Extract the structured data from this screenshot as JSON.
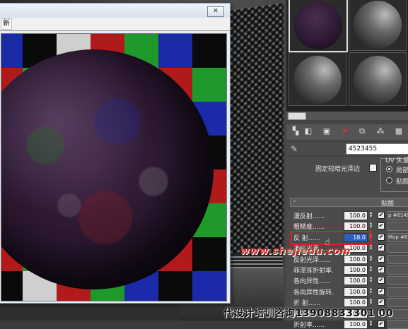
{
  "window": {
    "close_label": "✕",
    "menu_item": "新"
  },
  "checker_colors": [
    "#0a0a0a",
    "#1a2aa8",
    "#0a0a0a",
    "#cfcfcf",
    "#b01a1a",
    "#1f9a2a",
    "#1a2aa8",
    "#0a0a0a",
    "#b01a1a",
    "#1f9a2a",
    "#cfcfcf"
  ],
  "material_editor": {
    "material_name": "4523455",
    "checkbox_label": "固定较暗光泽边",
    "uv_group_label": "UV 失量",
    "radio_options": [
      "局部",
      "贴图"
    ],
    "maps_rollout_label": "贴图",
    "maps_rollout_toggle": "-",
    "map_rows": [
      {
        "label": "漫反射......",
        "value": "100.0",
        "checked": true,
        "map": "p #6149"
      },
      {
        "label": "粗糙度......",
        "value": "100.0",
        "checked": true,
        "map": ""
      },
      {
        "label": "反  射......",
        "value": "18.0",
        "checked": true,
        "map": "Map #6"
      },
      {
        "label": "高光光泽......",
        "value": "100.0",
        "checked": true,
        "map": ""
      },
      {
        "label": "反射光泽......",
        "value": "100.0",
        "checked": true,
        "map": ""
      },
      {
        "label": "菲涅耳折射率.",
        "value": "100.0",
        "checked": true,
        "map": ""
      },
      {
        "label": "各向异性......",
        "value": "100.0",
        "checked": true,
        "map": ""
      },
      {
        "label": "各向异性旋转.",
        "value": "100.0",
        "checked": true,
        "map": ""
      },
      {
        "label": "折  射......",
        "value": "100.0",
        "checked": true,
        "map": ""
      },
      {
        "label": "光泽度......",
        "value": "100.0",
        "checked": true,
        "map": ""
      },
      {
        "label": "折射率......",
        "value": "100.0",
        "checked": true,
        "map": ""
      }
    ],
    "toolbar_icons": [
      "get-material-icon",
      "put-to-scene-icon",
      "assign-material-icon",
      "delete-icon",
      "copy-icon",
      "unique-icon",
      "put-to-library-icon"
    ]
  },
  "watermark": "www.shejiedu.com",
  "footer_text": "代设计培训咨询13908833301 00"
}
